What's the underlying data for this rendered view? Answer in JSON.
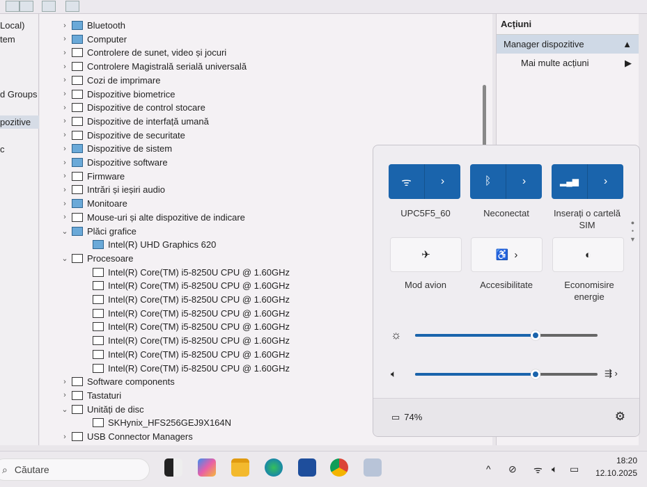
{
  "left_pane": [
    "Local)",
    "tem",
    "d Groups",
    "pozitive",
    "c"
  ],
  "tree": [
    {
      "label": "Bluetooth",
      "level": 0,
      "exp": false,
      "blue": true
    },
    {
      "label": "Computer",
      "level": 0,
      "exp": false,
      "blue": true
    },
    {
      "label": "Controlere de sunet, video și jocuri",
      "level": 0,
      "exp": false
    },
    {
      "label": "Controlere Magistrală serială universală",
      "level": 0,
      "exp": false
    },
    {
      "label": "Cozi de imprimare",
      "level": 0,
      "exp": false
    },
    {
      "label": "Dispozitive biometrice",
      "level": 0,
      "exp": false
    },
    {
      "label": "Dispozitive de control stocare",
      "level": 0,
      "exp": false
    },
    {
      "label": "Dispozitive de interfață umană",
      "level": 0,
      "exp": false
    },
    {
      "label": "Dispozitive de securitate",
      "level": 0,
      "exp": false
    },
    {
      "label": "Dispozitive de sistem",
      "level": 0,
      "exp": false,
      "blue": true
    },
    {
      "label": "Dispozitive software",
      "level": 0,
      "exp": false,
      "blue": true
    },
    {
      "label": "Firmware",
      "level": 0,
      "exp": false
    },
    {
      "label": "Intrări și ieșiri audio",
      "level": 0,
      "exp": false
    },
    {
      "label": "Monitoare",
      "level": 0,
      "exp": false,
      "blue": true
    },
    {
      "label": "Mouse-uri și alte dispozitive de indicare",
      "level": 0,
      "exp": false
    },
    {
      "label": "Plăci grafice",
      "level": 0,
      "exp": true,
      "blue": true
    },
    {
      "label": "Intel(R) UHD Graphics 620",
      "level": 1,
      "blue": true
    },
    {
      "label": "Procesoare",
      "level": 0,
      "exp": true
    },
    {
      "label": "Intel(R) Core(TM) i5-8250U CPU @ 1.60GHz",
      "level": 1
    },
    {
      "label": "Intel(R) Core(TM) i5-8250U CPU @ 1.60GHz",
      "level": 1
    },
    {
      "label": "Intel(R) Core(TM) i5-8250U CPU @ 1.60GHz",
      "level": 1
    },
    {
      "label": "Intel(R) Core(TM) i5-8250U CPU @ 1.60GHz",
      "level": 1
    },
    {
      "label": "Intel(R) Core(TM) i5-8250U CPU @ 1.60GHz",
      "level": 1
    },
    {
      "label": "Intel(R) Core(TM) i5-8250U CPU @ 1.60GHz",
      "level": 1
    },
    {
      "label": "Intel(R) Core(TM) i5-8250U CPU @ 1.60GHz",
      "level": 1
    },
    {
      "label": "Intel(R) Core(TM) i5-8250U CPU @ 1.60GHz",
      "level": 1
    },
    {
      "label": "Software components",
      "level": 0,
      "exp": false
    },
    {
      "label": "Tastaturi",
      "level": 0,
      "exp": false
    },
    {
      "label": "Unități de disc",
      "level": 0,
      "exp": true
    },
    {
      "label": "SKHynix_HFS256GEJ9X164N",
      "level": 1
    },
    {
      "label": "USB Connector Managers",
      "level": 0,
      "exp": false
    }
  ],
  "actions": {
    "title": "Acțiuni",
    "selected": "Manager dispozitive",
    "more": "Mai multe acțiuni"
  },
  "quick_settings": {
    "wifi_label": "UPC5F5_60",
    "bluetooth_label": "Neconectat",
    "cellular_label": "Inserați o cartelă SIM",
    "airplane_label": "Mod avion",
    "accessibility_label": "Accesibilitate",
    "energy_label": "Economisire energie",
    "brightness": 0.66,
    "volume": 0.66,
    "battery": "74%"
  },
  "taskbar": {
    "search_placeholder": "Căutare",
    "time": "18:20",
    "date": "12.10.2025"
  },
  "colors": {
    "accent": "#1a64ac"
  }
}
